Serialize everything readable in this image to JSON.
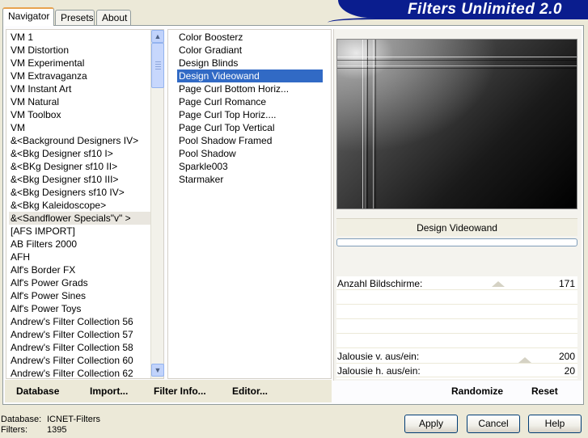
{
  "banner": {
    "title": "Filters Unlimited 2.0"
  },
  "tabs": [
    {
      "label": "Navigator",
      "active": true
    },
    {
      "label": "Presets",
      "active": false
    },
    {
      "label": "About",
      "active": false
    }
  ],
  "categories": {
    "items": [
      "VM 1",
      "VM Distortion",
      "VM Experimental",
      "VM Extravaganza",
      "VM Instant Art",
      "VM Natural",
      "VM Toolbox",
      "VM",
      "&<Background Designers IV>",
      "&<Bkg Designer sf10 I>",
      "&<BKg Designer sf10 II>",
      "&<Bkg Designer sf10 III>",
      "&<Bkg Designers sf10 IV>",
      "&<Bkg Kaleidoscope>",
      "&<Sandflower Specials\"v\" >",
      "[AFS IMPORT]",
      "AB Filters 2000",
      "AFH",
      "Alf's Border FX",
      "Alf's Power Grads",
      "Alf's Power Sines",
      "Alf's Power Toys",
      "Andrew's Filter Collection 56",
      "Andrew's Filter Collection 57",
      "Andrew's Filter Collection 58",
      "Andrew's Filter Collection 60",
      "Andrew's Filter Collection 62"
    ],
    "selected_index": 14
  },
  "filters": {
    "items": [
      "Color Boosterz",
      "Color Gradiant",
      "Design Blinds",
      "Design Videowand",
      "Page Curl Bottom Horiz...",
      "Page Curl Romance",
      "Page Curl Top Horiz....",
      "Page Curl Top Vertical",
      "Pool Shadow Framed",
      "Pool Shadow",
      "Sparkle003",
      "Starmaker"
    ],
    "selected_index": 3
  },
  "preview": {
    "filter_name": "Design Videowand"
  },
  "params": [
    {
      "label": "Anzahl Bildschirme:",
      "value": "171",
      "level": 0.67
    },
    {
      "label": "Jalousie v. aus/ein:",
      "value": "200",
      "level": 0.78
    },
    {
      "label": "Jalousie h. aus/ein:",
      "value": "20",
      "level": 0.08
    }
  ],
  "toolbar": {
    "database": "Database",
    "import": "Import...",
    "filter_info": "Filter Info...",
    "editor": "Editor...",
    "randomize": "Randomize",
    "reset": "Reset"
  },
  "buttons": {
    "apply": "Apply",
    "cancel": "Cancel",
    "help": "Help"
  },
  "status": {
    "database_label": "Database:",
    "database_value": "ICNET-Filters",
    "filters_label": "Filters:",
    "filters_value": "1395"
  },
  "scrollbar": {
    "up_icon": "arrow-up-icon",
    "down_icon": "arrow-down-icon"
  }
}
